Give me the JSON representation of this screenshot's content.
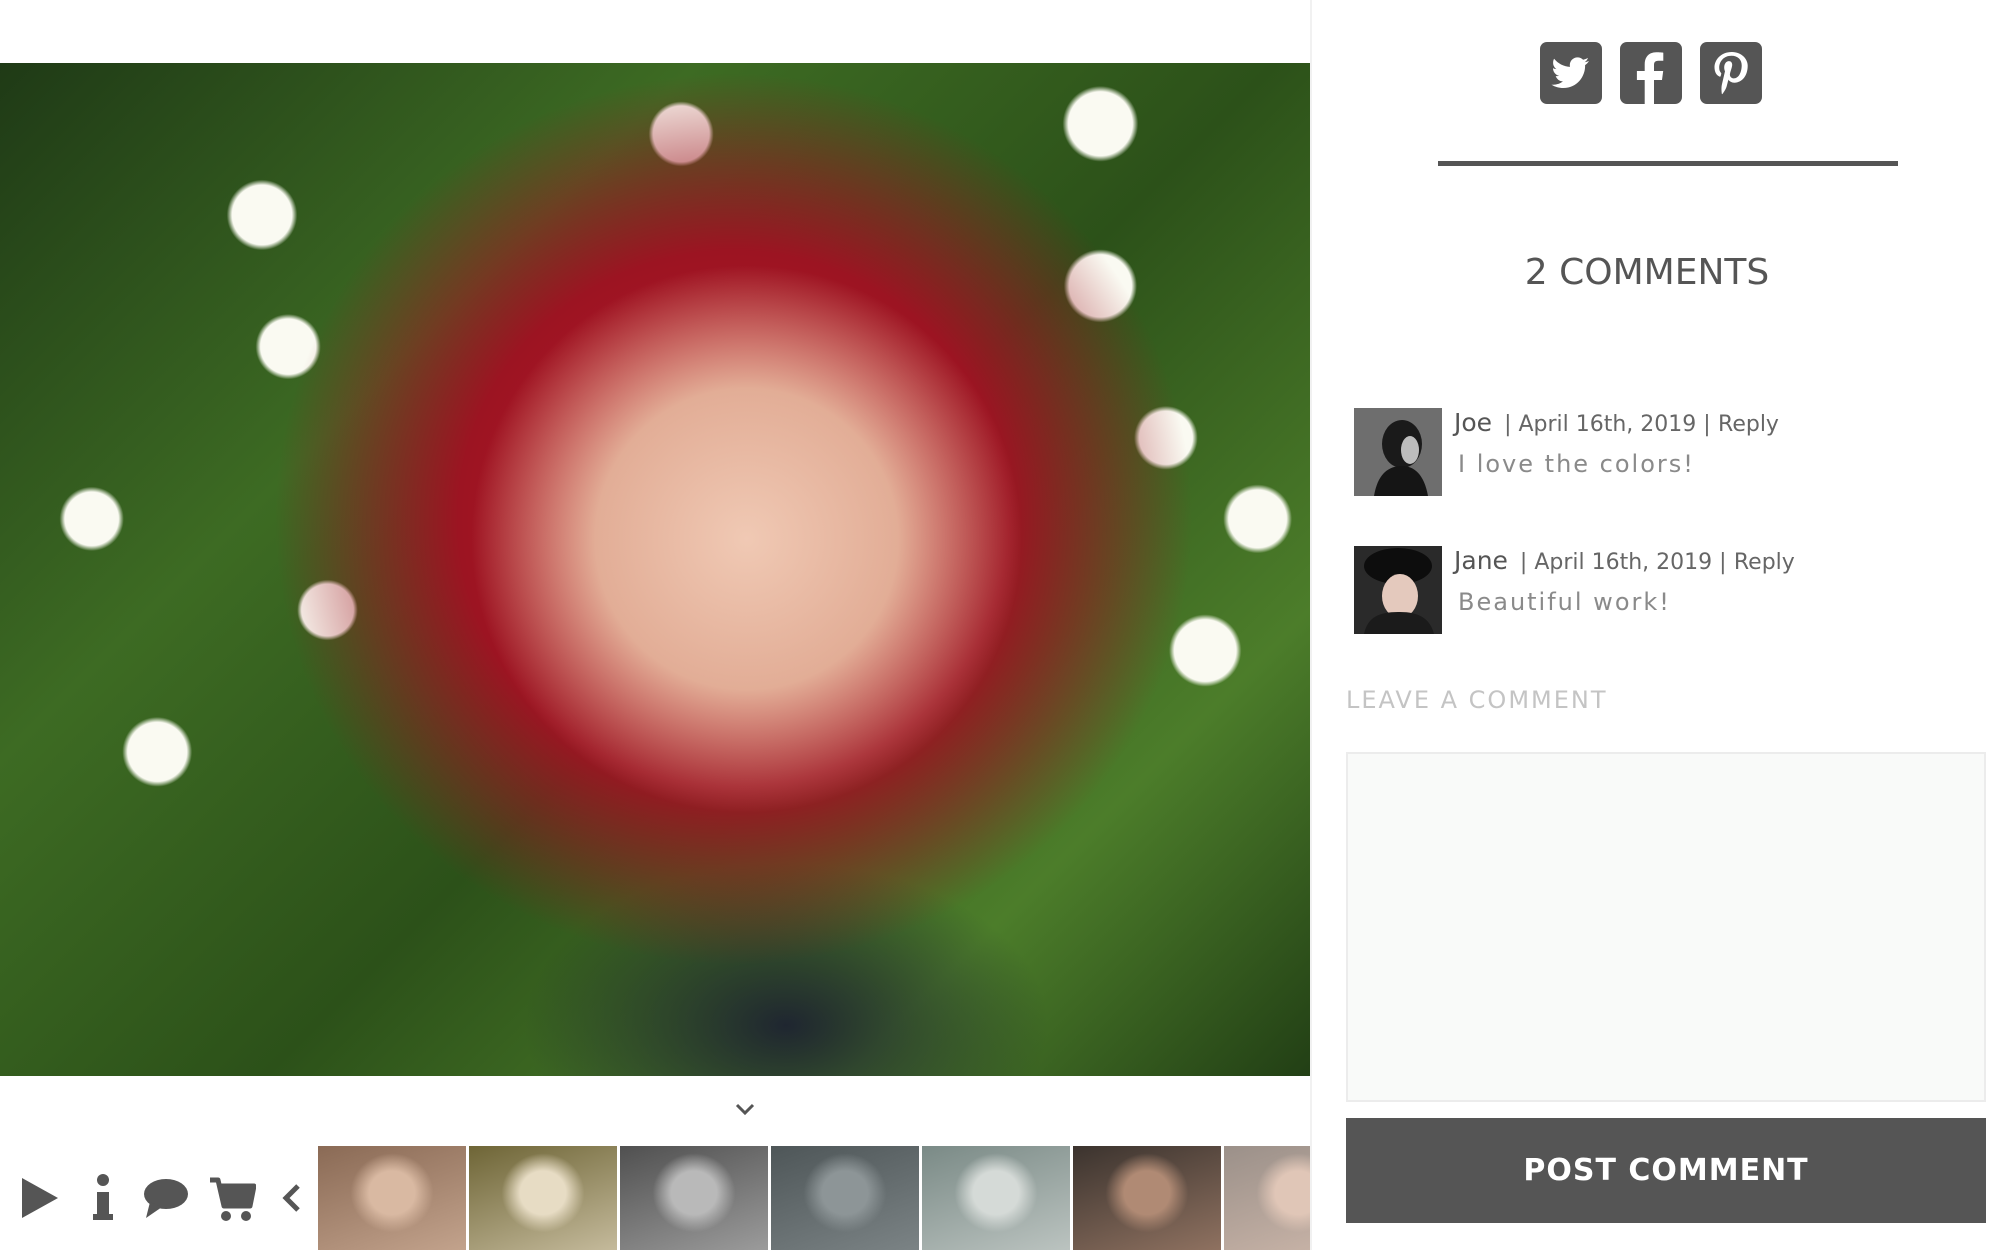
{
  "gallery": {
    "main_photo_alt": "",
    "toolbar": [
      {
        "name": "play-icon"
      },
      {
        "name": "info-icon"
      },
      {
        "name": "comment-icon"
      },
      {
        "name": "cart-icon"
      },
      {
        "name": "chevron-left-icon"
      }
    ],
    "thumbnails": [
      {
        "name": "thumbnail-1",
        "bg": "#8a6a55",
        "accent": "#d9b9a2"
      },
      {
        "name": "thumbnail-2",
        "bg": "#6e6536",
        "accent": "#e7dcc4"
      },
      {
        "name": "thumbnail-3",
        "bg": "#505050",
        "accent": "#b9b9b9"
      },
      {
        "name": "thumbnail-4",
        "bg": "#4e5658",
        "accent": "#8d9597"
      },
      {
        "name": "thumbnail-5",
        "bg": "#7a8a86",
        "accent": "#d5dad7"
      },
      {
        "name": "thumbnail-6",
        "bg": "#3b332e",
        "accent": "#b08a74"
      },
      {
        "name": "thumbnail-7",
        "bg": "#9b9089",
        "accent": "#e0c6b7"
      }
    ]
  },
  "share": {
    "icons": [
      "twitter-icon",
      "facebook-icon",
      "pinterest-icon"
    ],
    "color": "#555555"
  },
  "comments": {
    "title": "2 COMMENTS",
    "items": [
      {
        "author": "Joe",
        "meta": "| April 16th, 2019 |",
        "reply": "Reply",
        "text": "I love the colors!",
        "avatar_bg": "#4a4a4a"
      },
      {
        "author": "Jane",
        "meta": "| April 16th, 2019 |",
        "reply": "Reply",
        "text": "Beautiful work!",
        "avatar_bg": "#1d1d1d"
      }
    ]
  },
  "form": {
    "label": "LEAVE A COMMENT",
    "placeholder": "",
    "button": "POST COMMENT"
  },
  "colors": {
    "text_dark": "#555555",
    "text_light": "#8a8a8a",
    "button_bg": "#555555",
    "textarea_bg": "#f9faf9"
  }
}
